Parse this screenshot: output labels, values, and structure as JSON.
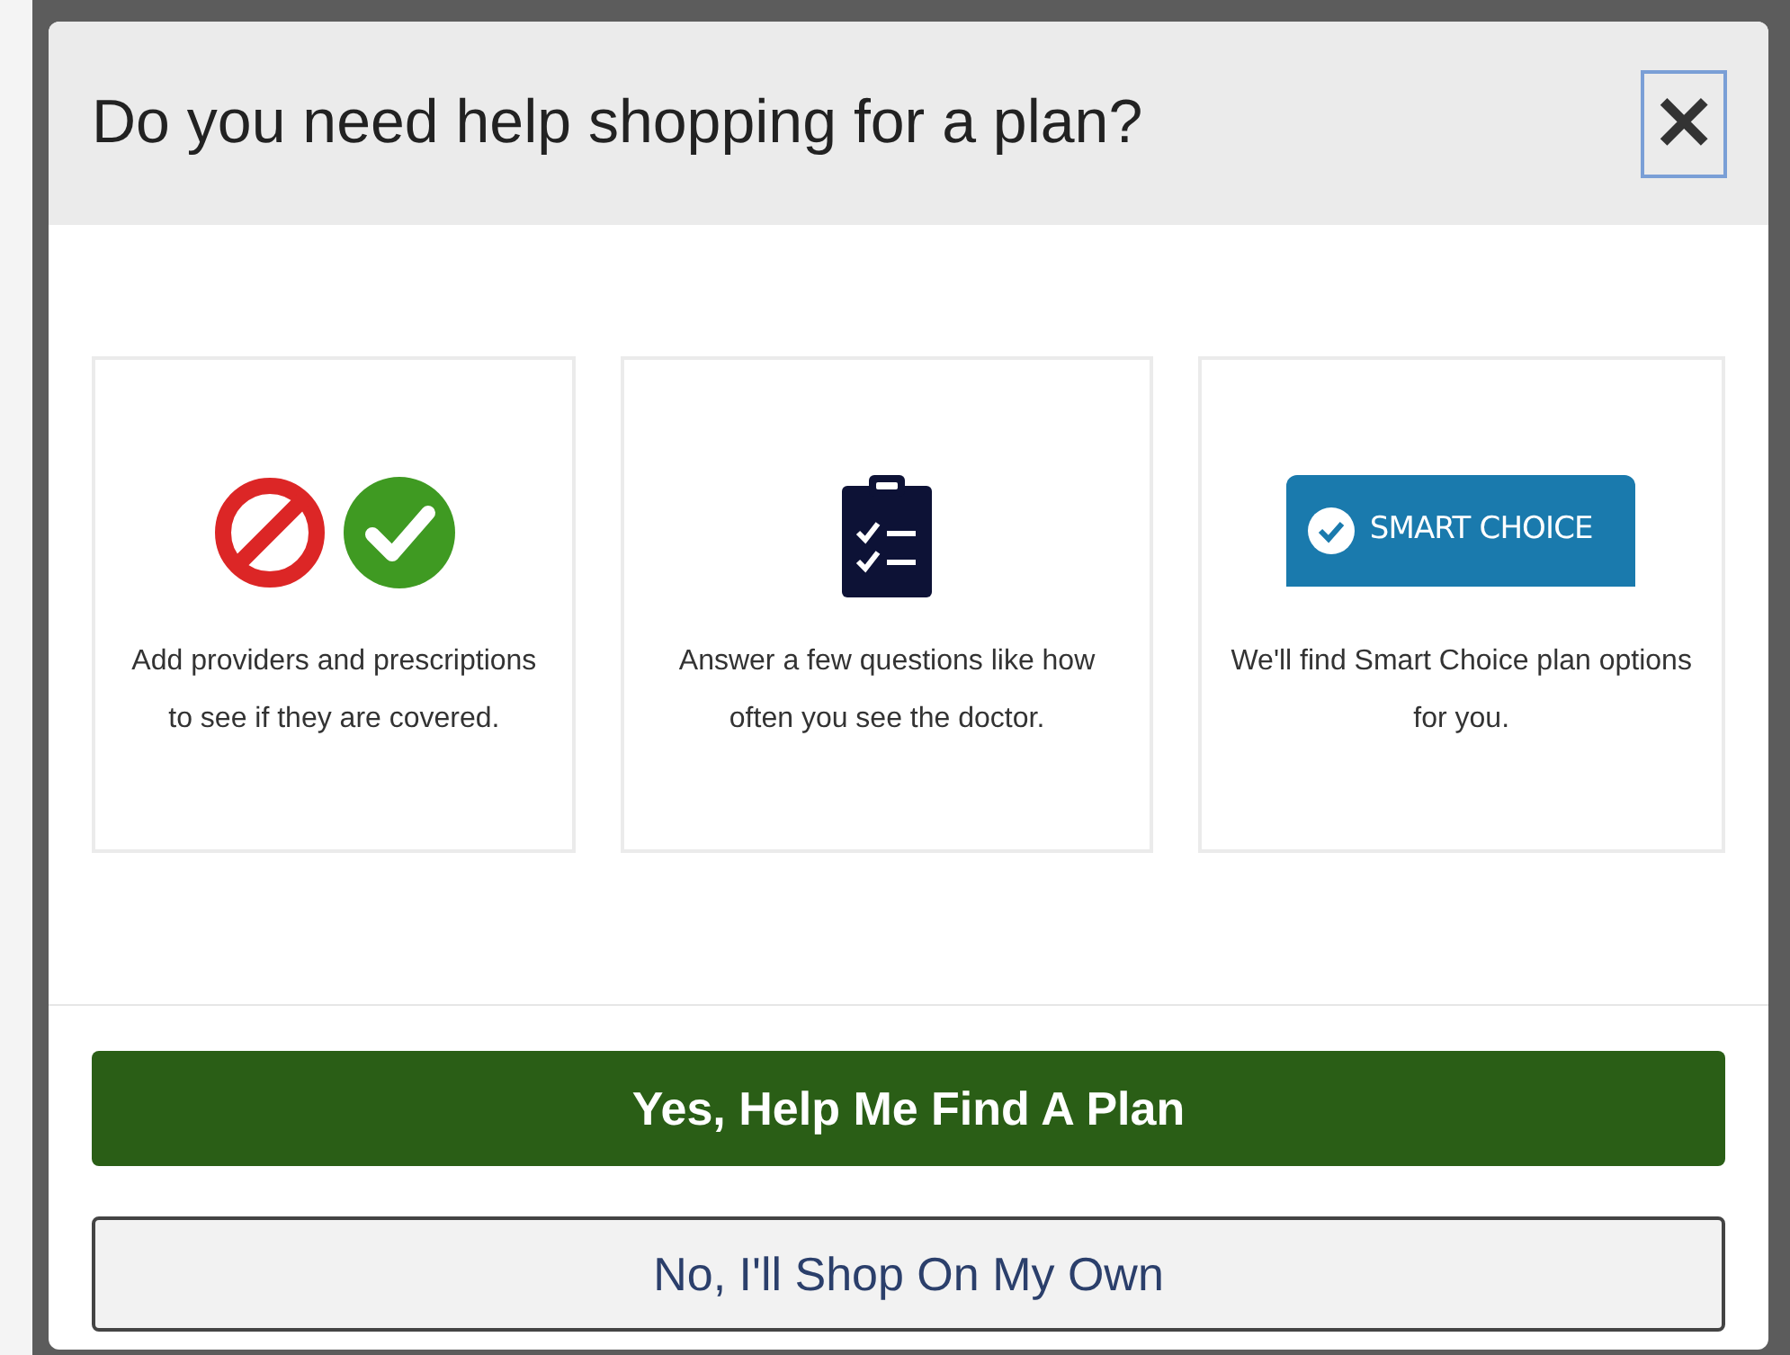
{
  "dialog": {
    "title": "Do you need help shopping for a plan?",
    "close_label": "✕"
  },
  "cards": [
    {
      "kind": "providers",
      "text": "Add providers and prescriptions to see if they are covered."
    },
    {
      "kind": "questions",
      "text": "Answer a few questions like how often you see the doctor."
    },
    {
      "kind": "badge",
      "badge": "SMART CHOICE",
      "text": "We'll find Smart Choice plan options for you."
    }
  ],
  "buttons": [
    {
      "kind": "primary",
      "label": "Yes, Help Me Find A Plan"
    },
    {
      "kind": "secondary",
      "label": "No, I'll Shop On My Own"
    }
  ]
}
